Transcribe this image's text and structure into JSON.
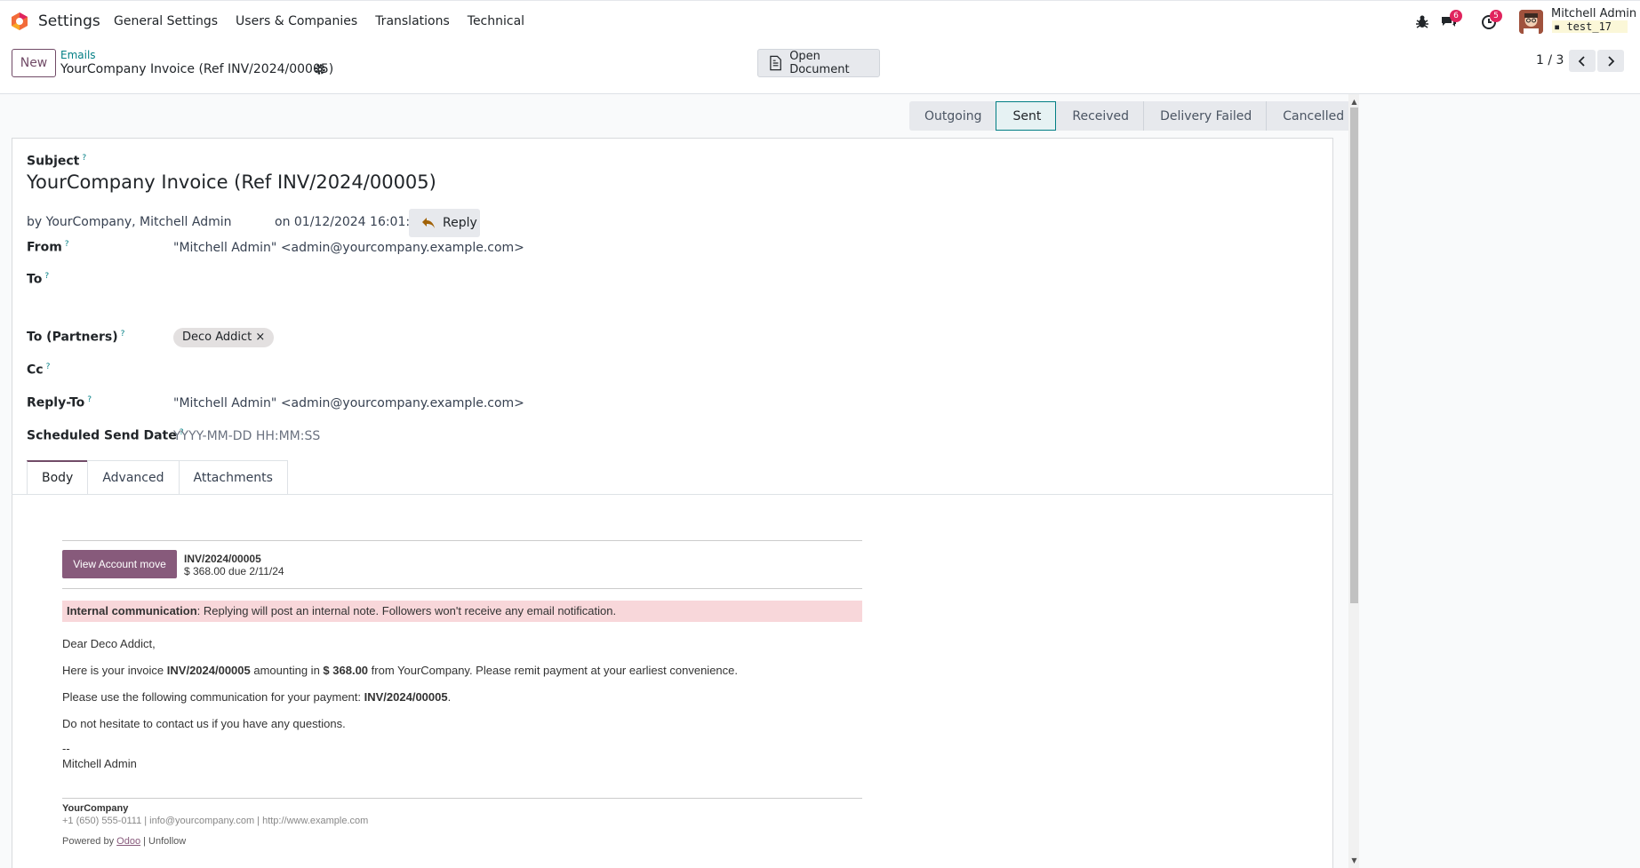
{
  "nav": {
    "app_name": "Settings",
    "menu": [
      "General Settings",
      "Users & Companies",
      "Translations",
      "Technical"
    ],
    "chat_count": "6",
    "activity_count": "5",
    "user_name": "Mitchell Admin",
    "db_name": "test_17"
  },
  "control_panel": {
    "new_label": "New",
    "breadcrumb_parent": "Emails",
    "breadcrumb_current": "YourCompany Invoice (Ref INV/2024/00005)",
    "open_document_label": "Open Document",
    "pager": "1 / 3"
  },
  "statusbar": {
    "stages": [
      "Outgoing",
      "Sent",
      "Received",
      "Delivery Failed",
      "Cancelled"
    ],
    "active": "Sent"
  },
  "form": {
    "subject_label": "Subject",
    "subject": "YourCompany Invoice (Ref INV/2024/00005)",
    "author": "by YourCompany, Mitchell Admin",
    "date": "on 01/12/2024 16:01:33",
    "reply_label": "Reply",
    "from_label": "From",
    "from_value": "\"Mitchell Admin\" <admin@yourcompany.example.com>",
    "to_label": "To",
    "to_partners_label": "To (Partners)",
    "partner_tag": "Deco Addict",
    "cc_label": "Cc",
    "reply_to_label": "Reply-To",
    "reply_to_value": "\"Mitchell Admin\" <admin@yourcompany.example.com>",
    "scheduled_label": "Scheduled Send Date",
    "scheduled_placeholder": "YYYY-MM-DD HH:MM:SS",
    "help_mark": "?"
  },
  "tabs": [
    "Body",
    "Advanced",
    "Attachments"
  ],
  "email": {
    "view_button": "View Account move",
    "invoice_ref": "INV/2024/00005",
    "invoice_due": "$ 368.00 due 2/11/24",
    "notice_bold": "Internal communication",
    "notice_rest": ": Replying will post an internal note. Followers won't receive any email notification.",
    "greeting": "Dear Deco Addict,",
    "line1_a": "Here is your invoice ",
    "line1_ref": "INV/2024/00005",
    "line1_b": " amounting in ",
    "line1_amount": "$ 368.00",
    "line1_c": " from YourCompany. Please remit payment at your earliest convenience.",
    "line2_a": "Please use the following communication for your payment: ",
    "line2_ref": "INV/2024/00005",
    "line2_b": ".",
    "line3": "Do not hesitate to contact us if you have any questions.",
    "sig_dash": "--",
    "sig_name": "Mitchell Admin",
    "footer_company": "YourCompany",
    "footer_contact": "+1 (650) 555-0111 | info@yourcompany.com | http://www.example.com",
    "footer_powered_by": "Powered by ",
    "footer_odoo": "Odoo",
    "footer_unfollow": " | Unfollow"
  },
  "colors": {
    "brand": "#714b67",
    "teal": "#017e84",
    "email_button": "#875a7b",
    "notice_bg": "#f8d7da",
    "badge": "#e0245e"
  }
}
